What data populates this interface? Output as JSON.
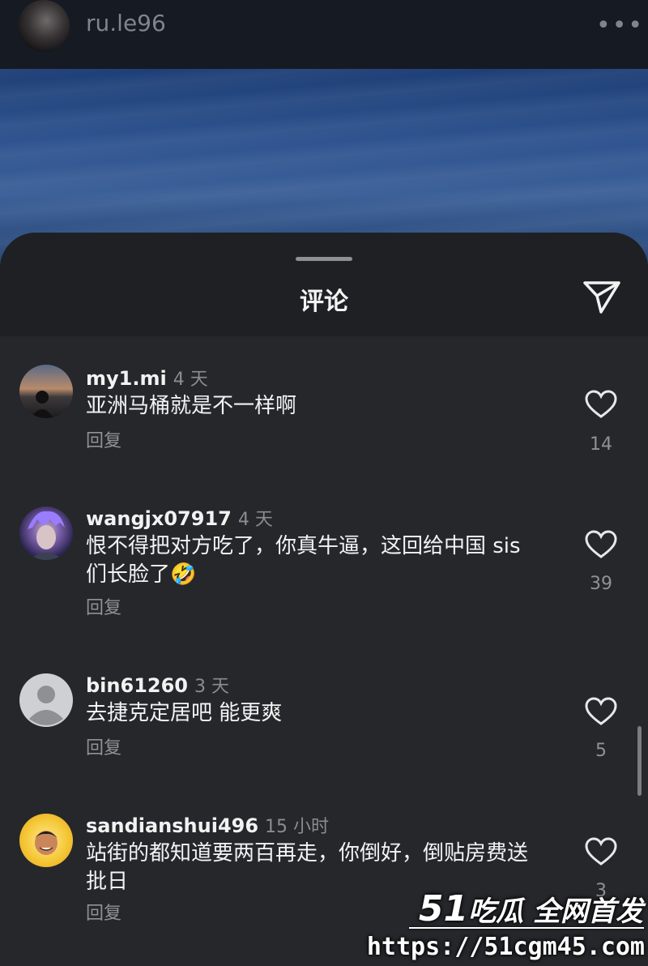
{
  "top_bar": {
    "username": "ru.le96",
    "more_label": "•••"
  },
  "sheet": {
    "title": "评论"
  },
  "comments": [
    {
      "user": "my1.mi",
      "time": "4 天",
      "text": "亚洲马桶就是不一样啊",
      "reply": "回复",
      "likes": "14"
    },
    {
      "user": "wangjx07917",
      "time": "4 天",
      "text": "恨不得把对方吃了，你真牛逼，这回给中国 sis 们长脸了🤣",
      "reply": "回复",
      "likes": "39"
    },
    {
      "user": "bin61260",
      "time": "3 天",
      "text": "去捷克定居吧  能更爽",
      "reply": "回复",
      "likes": "5"
    },
    {
      "user": "sandianshui496",
      "time": "15 小时",
      "text": "站街的都知道要两百再走，你倒好，倒贴房费送批日",
      "reply": "回复",
      "likes": "3"
    }
  ],
  "watermark": {
    "brand_number": "51",
    "brand_text": "吃瓜 全网首发",
    "url": "https://51cgm45.com"
  },
  "colors": {
    "background": "#26272b",
    "header": "#1f2024",
    "topbar": "#161a22",
    "muted_text": "#8f9197"
  }
}
